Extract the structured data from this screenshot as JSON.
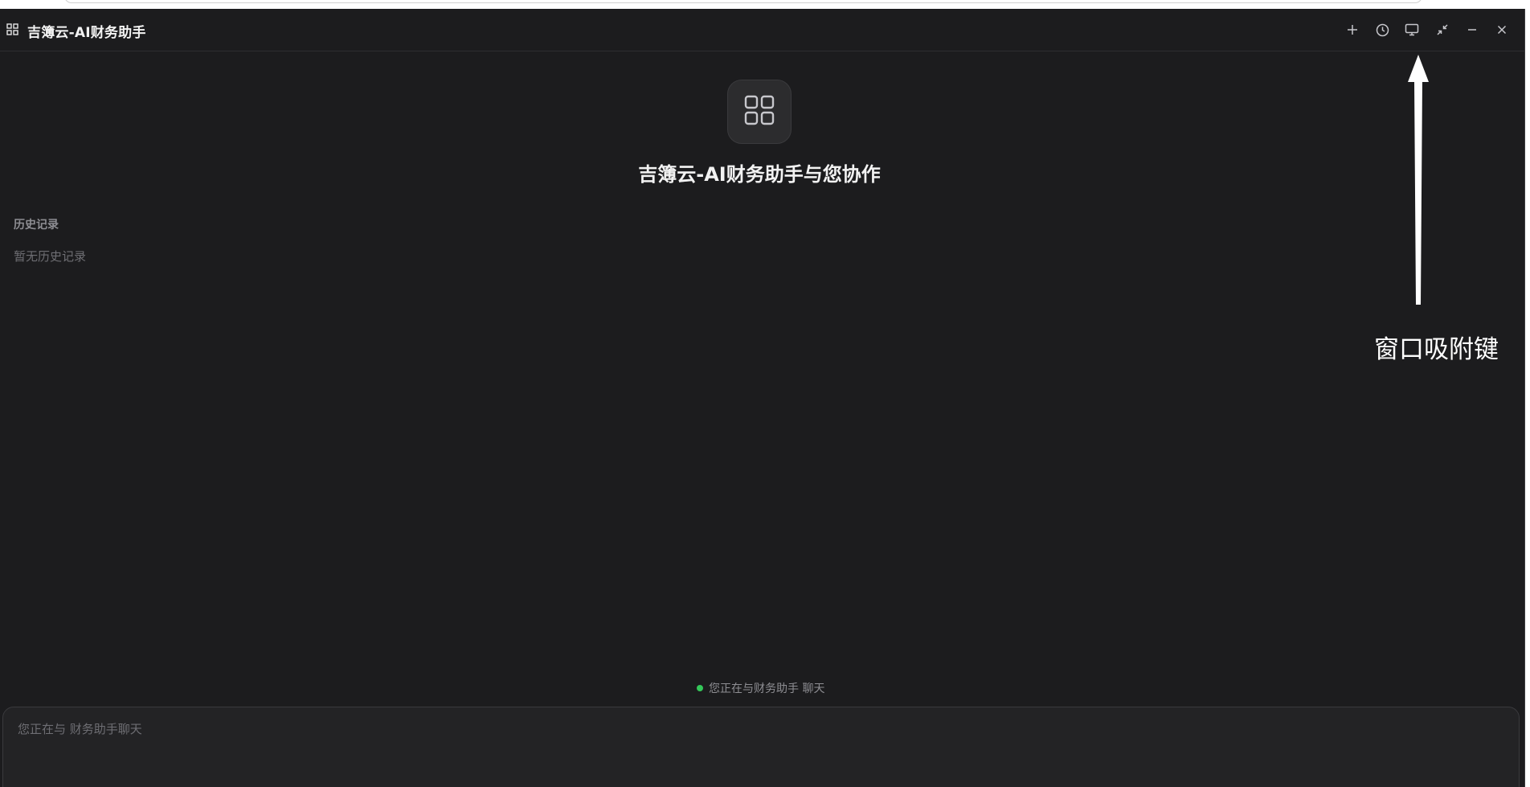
{
  "app": {
    "title": "吉簿云-AI财务助手",
    "icon": "grid-icon"
  },
  "titlebar": {
    "buttons": [
      {
        "name": "new-chat-button",
        "icon": "plus-icon"
      },
      {
        "name": "history-button",
        "icon": "clock-icon"
      },
      {
        "name": "window-snap-button",
        "icon": "monitor-icon"
      },
      {
        "name": "collapse-button",
        "icon": "collapse-arrows-icon"
      },
      {
        "name": "minimize-button",
        "icon": "minus-icon"
      },
      {
        "name": "close-button",
        "icon": "close-icon"
      }
    ]
  },
  "hero": {
    "title": "吉簿云-AI财务助手与您协作",
    "logo_icon": "grid-icon"
  },
  "sidebar": {
    "history_title": "历史记录",
    "history_empty": "暂无历史记录"
  },
  "annotation": {
    "label": "窗口吸附键"
  },
  "status": {
    "text": "您正在与财务助手 聊天",
    "dot_color": "#34c759"
  },
  "composer": {
    "placeholder": "您正在与 财务助手聊天",
    "value": ""
  },
  "colors": {
    "background": "#1c1c1e",
    "text": "#f2f2f2",
    "muted": "#8e8e93"
  }
}
